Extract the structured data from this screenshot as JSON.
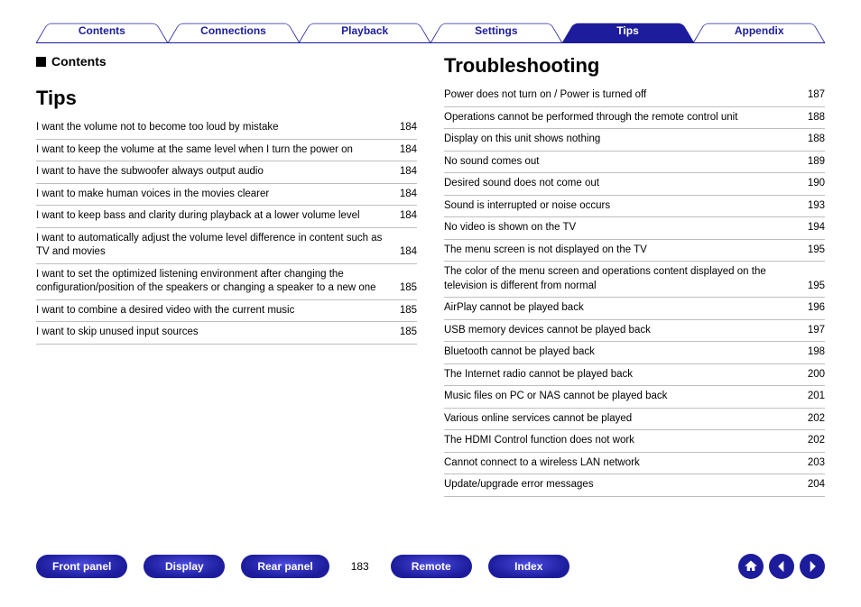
{
  "topnav": {
    "tabs": [
      {
        "label": "Contents"
      },
      {
        "label": "Connections"
      },
      {
        "label": "Playback"
      },
      {
        "label": "Settings"
      },
      {
        "label": "Tips",
        "active": true
      },
      {
        "label": "Appendix"
      }
    ]
  },
  "left": {
    "contentsLabel": "Contents",
    "sectionTitle": "Tips",
    "rows": [
      {
        "t": "I want the volume not to become too loud by mistake",
        "p": "184"
      },
      {
        "t": "I want to keep the volume at the same level when I turn the power on",
        "p": "184"
      },
      {
        "t": "I want to have the subwoofer always output audio",
        "p": "184"
      },
      {
        "t": "I want to make human voices in the movies clearer",
        "p": "184"
      },
      {
        "t": "I want to keep bass and clarity during playback at a lower volume level",
        "p": "184"
      },
      {
        "t": "I want to automatically adjust the volume level difference in content such as TV and movies",
        "p": "184"
      },
      {
        "t": "I want to set the optimized listening environment after changing the configuration/position of the speakers or changing a speaker to a new one",
        "p": "185"
      },
      {
        "t": "I want to combine a desired video with the current music",
        "p": "185"
      },
      {
        "t": "I want to skip unused input sources",
        "p": "185"
      }
    ]
  },
  "right": {
    "sectionTitle": "Troubleshooting",
    "rows": [
      {
        "t": "Power does not turn on / Power is turned off",
        "p": "187"
      },
      {
        "t": "Operations cannot be performed through the remote control unit",
        "p": "188"
      },
      {
        "t": "Display on this unit shows nothing",
        "p": "188"
      },
      {
        "t": "No sound comes out",
        "p": "189"
      },
      {
        "t": "Desired sound does not come out",
        "p": "190"
      },
      {
        "t": "Sound is interrupted or noise occurs",
        "p": "193"
      },
      {
        "t": "No video is shown on the TV",
        "p": "194"
      },
      {
        "t": "The menu screen is not displayed on the TV",
        "p": "195"
      },
      {
        "t": "The color of the menu screen and operations content displayed on the television is different from normal",
        "p": "195"
      },
      {
        "t": "AirPlay cannot be played back",
        "p": "196"
      },
      {
        "t": "USB memory devices cannot be played back",
        "p": "197"
      },
      {
        "t": "Bluetooth cannot be played back",
        "p": "198"
      },
      {
        "t": "The Internet radio cannot be played back",
        "p": "200"
      },
      {
        "t": "Music files on PC or NAS cannot be played back",
        "p": "201"
      },
      {
        "t": "Various online services cannot be played",
        "p": "202"
      },
      {
        "t": "The HDMI Control function does not work",
        "p": "202"
      },
      {
        "t": "Cannot connect to a wireless LAN network",
        "p": "203"
      },
      {
        "t": "Update/upgrade error messages",
        "p": "204"
      }
    ]
  },
  "bottom": {
    "pills": [
      "Front panel",
      "Display",
      "Rear panel"
    ],
    "pageNumber": "183",
    "pills2": [
      "Remote",
      "Index"
    ]
  }
}
